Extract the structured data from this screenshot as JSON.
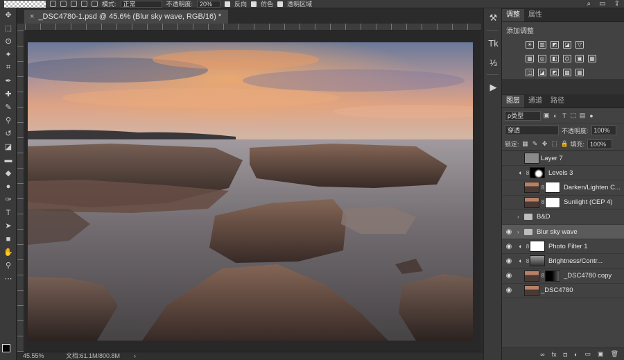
{
  "options_bar": {
    "mode_label": "模式:",
    "mode_value": "正常",
    "opacity_label": "不透明度:",
    "opacity_value": "20%",
    "reverse_label": "反向",
    "dither_label": "仿色",
    "transparency_label": "透明区域"
  },
  "document": {
    "tab_title": "_DSC4780-1.psd @ 45.6% (Blur sky wave, RGB/16) *",
    "close_glyph": "×"
  },
  "status_bar": {
    "zoom": "45.55%",
    "doc_size": "文档:61.1M/800.8M",
    "arrow": "›"
  },
  "tools": [
    "move-tool",
    "marquee-tool",
    "lasso-tool",
    "magic-wand-tool",
    "crop-tool",
    "eyedropper-tool",
    "healing-brush-tool",
    "brush-tool",
    "stamp-tool",
    "history-brush-tool",
    "eraser-tool",
    "gradient-tool",
    "blur-tool",
    "dodge-tool",
    "pen-tool",
    "type-tool",
    "path-selection-tool",
    "shape-tool",
    "hand-tool",
    "zoom-tool",
    "more-tools"
  ],
  "tool_glyphs": [
    "✥",
    "⬚",
    "ʘ",
    "✦",
    "⌗",
    "✒",
    "✚",
    "✎",
    "⚲",
    "↺",
    "◪",
    "▬",
    "◆",
    "●",
    "✑",
    "T",
    "➤",
    "■",
    "✋",
    "⚲",
    "⋯"
  ],
  "icon_column": {
    "glyphs": [
      "⚒",
      "Tk",
      "⅓",
      "▶"
    ]
  },
  "adjustments_panel": {
    "tabs": [
      "调整",
      "属性"
    ],
    "title": "添加调整",
    "row1": [
      "☀",
      "▥",
      "◩",
      "◪",
      "▽"
    ],
    "row2": [
      "▦",
      "◎",
      "◧",
      "⛭",
      "▣",
      "▦"
    ],
    "row3": [
      "◫",
      "◪",
      "◩",
      "▩",
      "▦"
    ]
  },
  "layers_panel": {
    "tabs": [
      "图层",
      "通道",
      "路径"
    ],
    "filter_label": "ρ类型",
    "blend_mode": "穿透",
    "opacity_label": "不透明度:",
    "opacity_value": "100%",
    "lock_label": "锁定:",
    "fill_label": "填充:",
    "fill_value": "100%",
    "layers": [
      {
        "name": "Layer 7",
        "visible": false,
        "type": "pixel",
        "thumb": "#8a8a8a"
      },
      {
        "name": "Levels 3",
        "visible": false,
        "type": "adjustment",
        "mask": "dark"
      },
      {
        "name": "Darken/Lighten C...",
        "visible": false,
        "type": "smart",
        "mask": "white"
      },
      {
        "name": "Sunlight (CEP 4)",
        "visible": false,
        "type": "smart",
        "mask": "white"
      },
      {
        "name": "B&D",
        "visible": false,
        "type": "group"
      },
      {
        "name": "Blur sky wave",
        "visible": true,
        "type": "group",
        "selected": true
      },
      {
        "name": "Photo Filter 1",
        "visible": true,
        "type": "adjustment",
        "mask": "white"
      },
      {
        "name": "Brightness/Contr...",
        "visible": true,
        "type": "adjustment",
        "mask": "photo"
      },
      {
        "name": "_DSC4780 copy",
        "visible": true,
        "type": "smart",
        "mask": "dark"
      },
      {
        "name": "_DSC4780",
        "visible": true,
        "type": "pixel",
        "thumb": "photo"
      }
    ],
    "footer_icons": [
      "∞",
      "fx",
      "◘",
      "◐",
      "▭",
      "▣",
      "🗑"
    ]
  }
}
